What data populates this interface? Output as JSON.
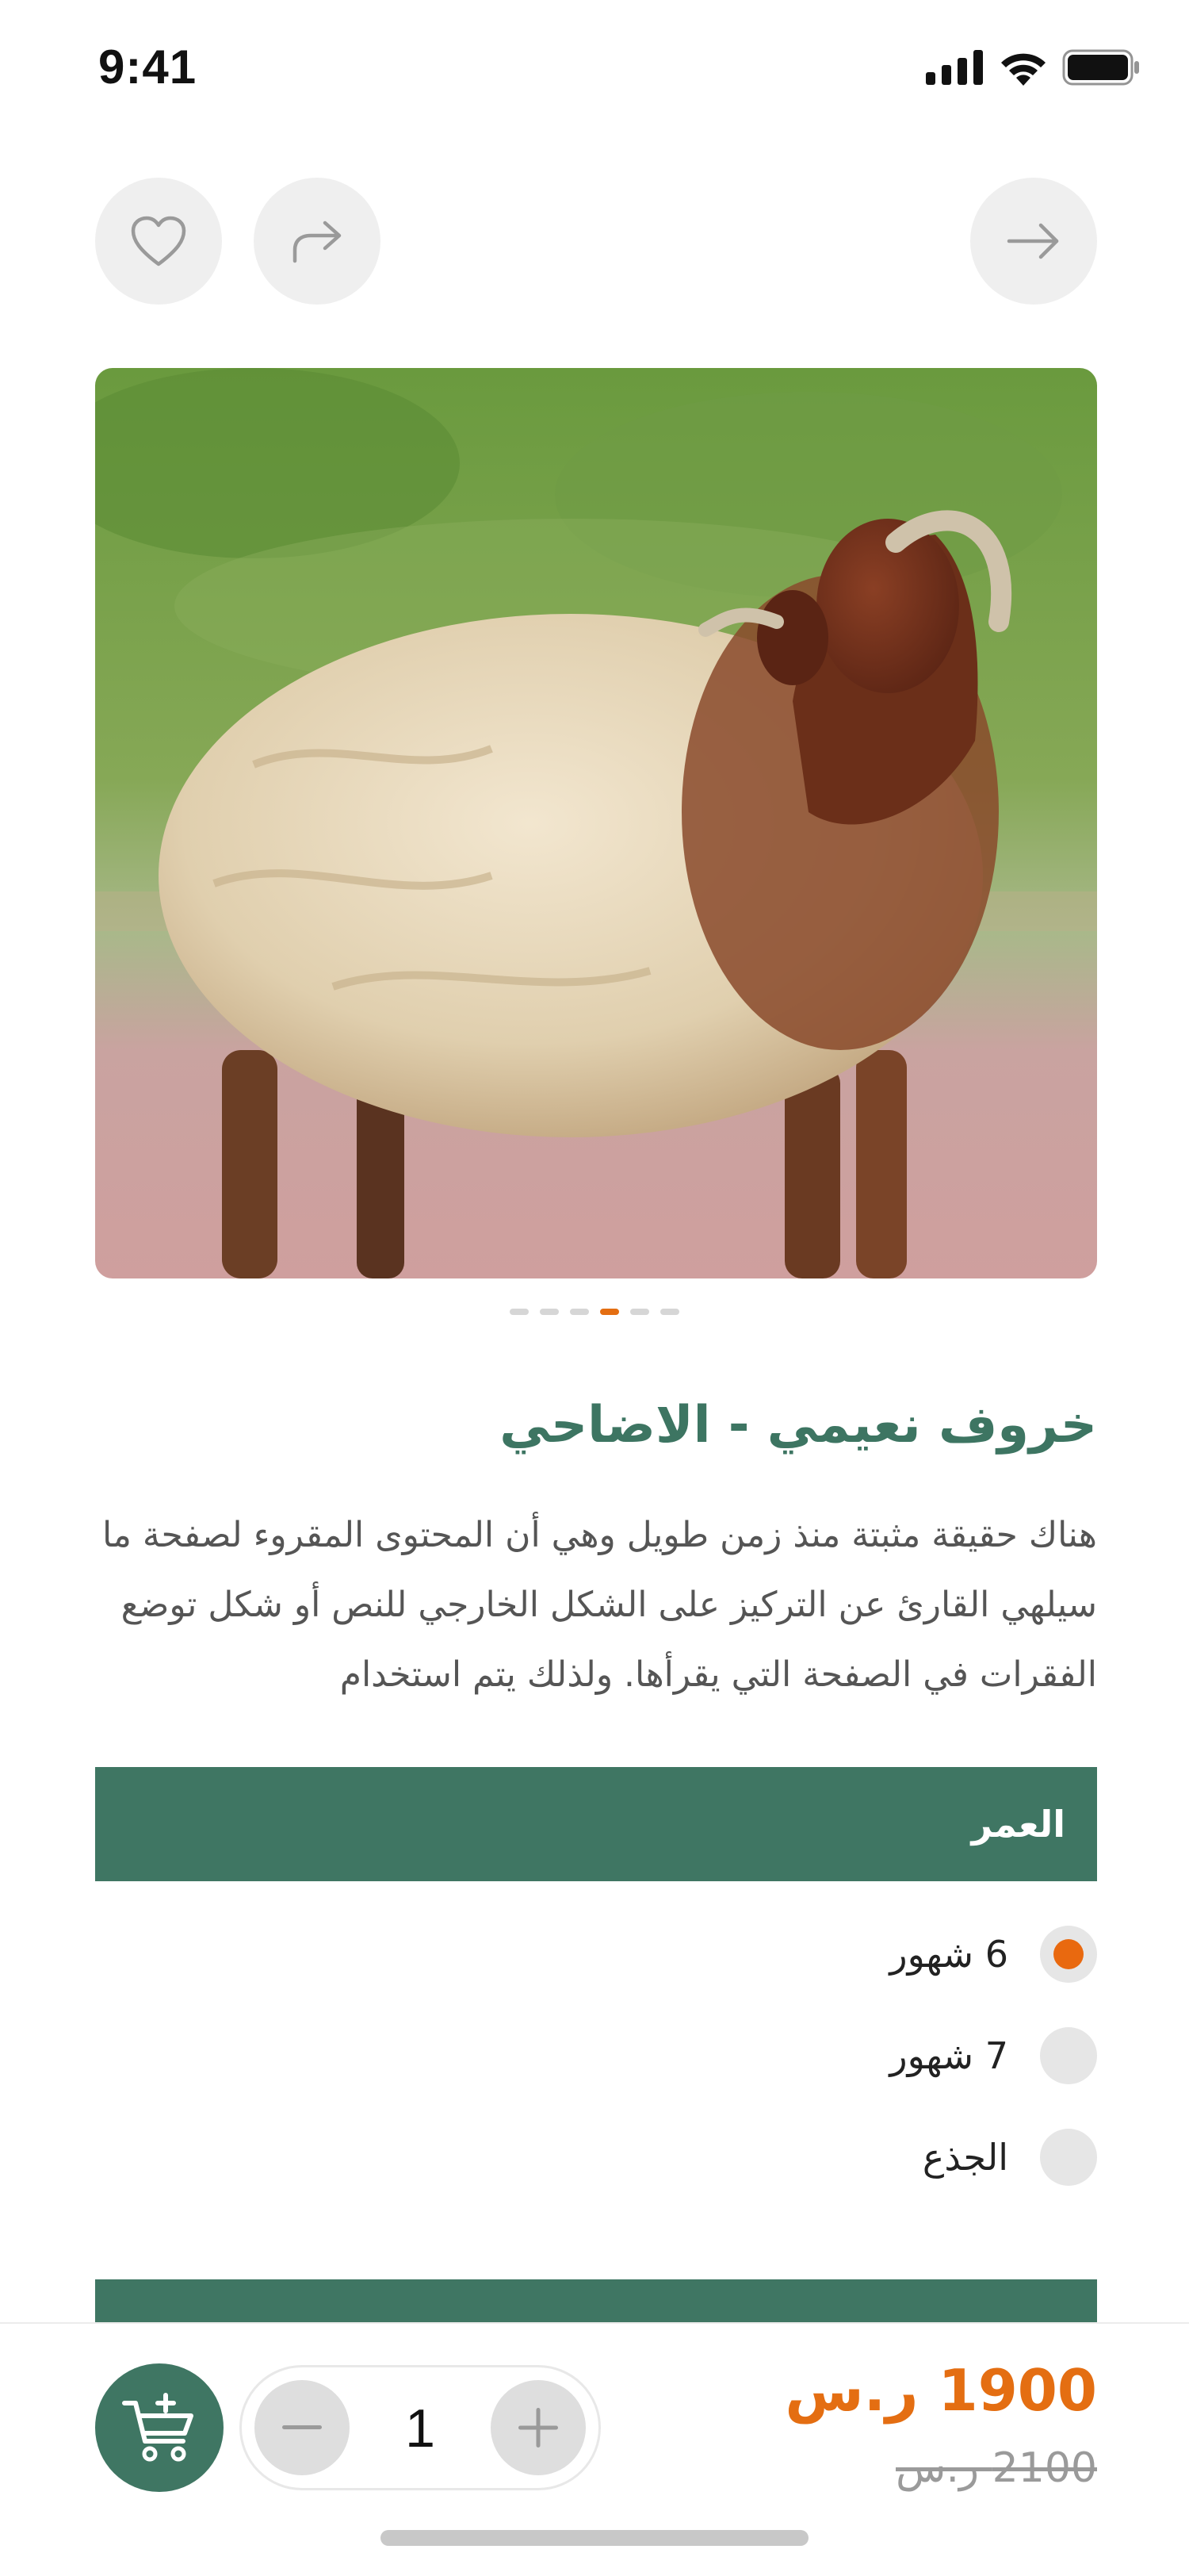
{
  "status_bar": {
    "time": "9:41"
  },
  "icons": {
    "favorite": "heart-icon",
    "share": "share-icon",
    "back": "arrow-right-icon",
    "cart": "add-to-cart-icon",
    "minus": "minus-icon",
    "plus": "plus-icon"
  },
  "product": {
    "title": "خروف نعيمي - الاضاحي",
    "description": "هناك حقيقة مثبتة منذ زمن طويل وهي أن المحتوى المقروء لصفحة ما سيلهي القارئ عن التركيز على الشكل الخارجي للنص أو شكل توضع الفقرات في الصفحة التي يقرأها. ولذلك يتم استخدام",
    "gallery": {
      "current_index": 4,
      "total": 6
    }
  },
  "age_section": {
    "header": "العمر",
    "options": [
      {
        "label": "6 شهور",
        "selected": true
      },
      {
        "label": "7 شهور",
        "selected": false
      },
      {
        "label": "الجذع",
        "selected": false
      }
    ]
  },
  "purchase": {
    "quantity": "1",
    "price": "1900 ر.س",
    "old_price": "2100 ر.س"
  },
  "colors": {
    "brand_green": "#3f7663",
    "accent_orange": "#e46e12",
    "muted_gray": "#efefef"
  }
}
